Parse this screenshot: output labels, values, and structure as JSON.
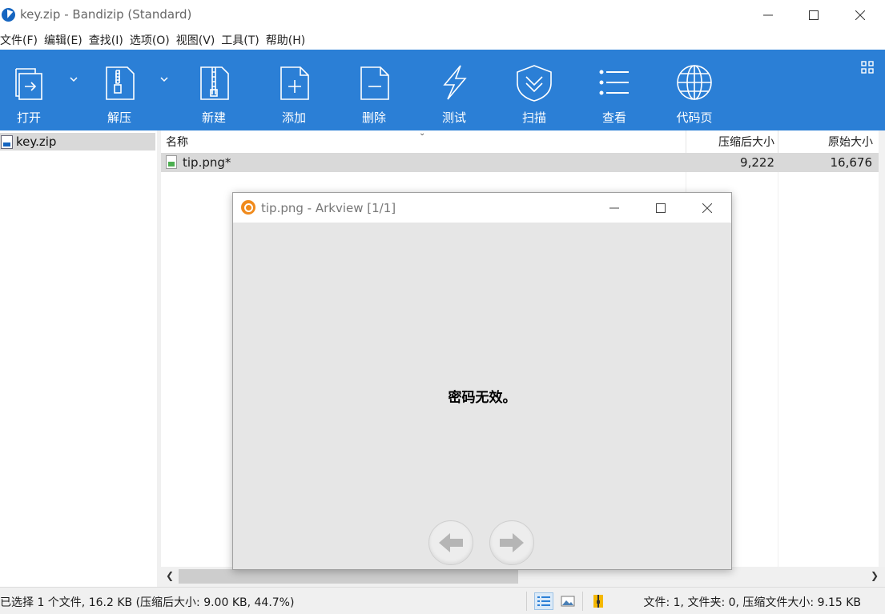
{
  "window": {
    "title": "key.zip - Bandizip (Standard)"
  },
  "menu": [
    {
      "label": "文件(F)"
    },
    {
      "label": "编辑(E)"
    },
    {
      "label": "查找(I)"
    },
    {
      "label": "选项(O)"
    },
    {
      "label": "视图(V)"
    },
    {
      "label": "工具(T)"
    },
    {
      "label": "帮助(H)"
    }
  ],
  "toolbar": {
    "background": "#2b7fd6",
    "buttons": [
      {
        "label": "打开",
        "icon": "open-icon"
      },
      {
        "label": "解压",
        "icon": "extract-icon"
      },
      {
        "label": "新建",
        "icon": "new-archive-icon"
      },
      {
        "label": "添加",
        "icon": "add-file-icon"
      },
      {
        "label": "删除",
        "icon": "delete-file-icon"
      },
      {
        "label": "测试",
        "icon": "lightning-icon"
      },
      {
        "label": "扫描",
        "icon": "shield-icon"
      },
      {
        "label": "查看",
        "icon": "list-view-icon"
      },
      {
        "label": "代码页",
        "icon": "globe-icon"
      }
    ]
  },
  "tree": {
    "items": [
      {
        "label": "key.zip",
        "icon": "zip-file-icon",
        "selected": true
      }
    ]
  },
  "file_list": {
    "columns": {
      "name": "名称",
      "compressed_size": "压缩后大小",
      "original_size": "原始大小"
    },
    "rows": [
      {
        "name": "tip.png*",
        "compressed_size": "9,222",
        "original_size": "16,676",
        "icon": "image-file-icon",
        "selected": true
      }
    ]
  },
  "status": {
    "left": "已选择 1 个文件, 16.2 KB (压缩后大小: 9.00 KB, 44.7%)",
    "right": "文件: 1, 文件夹: 0, 压缩文件大小: 9.15 KB"
  },
  "viewer": {
    "title": "tip.png - Arkview [1/1]",
    "message": "密码无效。",
    "prev_icon": "arrow-left-icon",
    "next_icon": "arrow-right-icon"
  }
}
